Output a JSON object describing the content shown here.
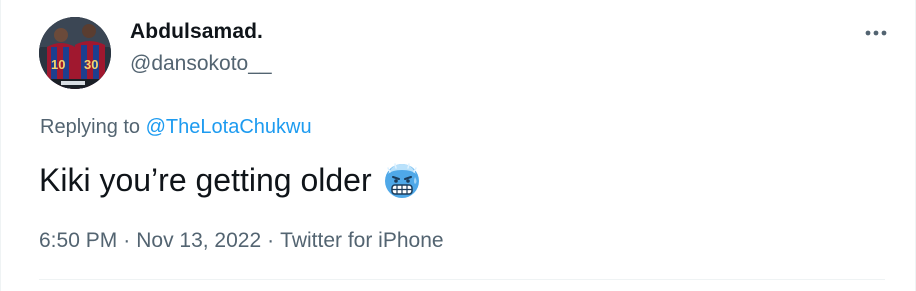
{
  "tweet": {
    "author": {
      "display_name": "Abdulsamad.",
      "handle": "@dansokoto__",
      "avatar_jersey_numbers": [
        "10",
        "30"
      ]
    },
    "reply": {
      "prefix": "Replying to",
      "mention": "@TheLotaChukwu"
    },
    "text": "Kiki you’re getting older",
    "emoji": "cold-face-icon",
    "meta": {
      "time": "6:50 PM",
      "separator": "·",
      "date": "Nov 13, 2022",
      "source": "Twitter for iPhone"
    }
  },
  "colors": {
    "text_primary": "#0f1419",
    "text_secondary": "#536471",
    "link": "#1d9bf0",
    "divider": "#eff3f4"
  }
}
